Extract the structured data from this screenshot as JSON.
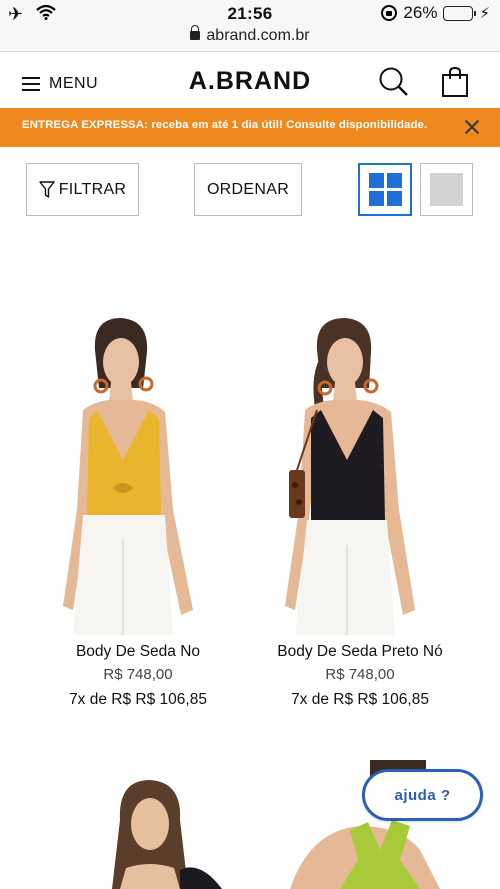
{
  "status_bar": {
    "time": "21:56",
    "battery_percent": "26%",
    "battery_level": 0.26,
    "icons": [
      "airplane-icon",
      "wifi-icon",
      "rotation-lock-icon",
      "battery-icon",
      "charging-icon"
    ]
  },
  "browser": {
    "url": "abrand.com.br",
    "icon": "padlock-icon"
  },
  "header": {
    "menu_label": "MENU",
    "logo": "A.BRAND",
    "icons": [
      "hamburger-icon",
      "search-icon",
      "shopping-bag-icon"
    ]
  },
  "promo": {
    "text": "ENTREGA EXPRESSA: receba em até 1 dia útil! Consulte disponibilidade.",
    "background": "#f0891d"
  },
  "toolbar": {
    "filter_label": "FILTRAR",
    "order_label": "ORDENAR",
    "accent": "#1f6fd6"
  },
  "products": [
    {
      "name": "Body De Seda No",
      "price": "R$ 748,00",
      "installments": "7x de R$ R$ 106,85",
      "top_color": "#e8b52c"
    },
    {
      "name": "Body De Seda Preto Nó",
      "price": "R$ 748,00",
      "installments": "7x de R$ R$ 106,85",
      "top_color": "#1e1c20"
    }
  ],
  "help": {
    "label": "ajuda ?",
    "color": "#2a5fb8"
  }
}
